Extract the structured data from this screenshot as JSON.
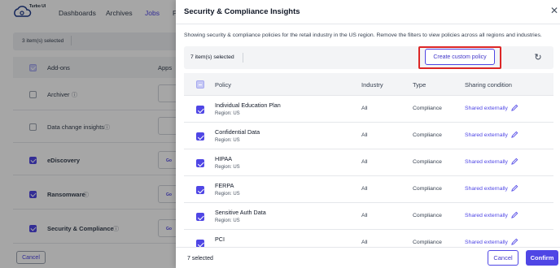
{
  "background": {
    "app_name": "Turbo UI",
    "nav": [
      "Dashboards",
      "Archives",
      "Jobs",
      "P"
    ],
    "active_nav": "Jobs",
    "selected_text": "3 item(s) selected",
    "columns": {
      "addons": "Add-ons",
      "apps": "Apps"
    },
    "rows": [
      {
        "label": "Archiver",
        "checked": false,
        "info_icon": "info-icon"
      },
      {
        "label": "Data change insights",
        "checked": false,
        "info_icon": "info-icon"
      },
      {
        "label": "eDiscovery",
        "checked": true,
        "chip": "Go"
      },
      {
        "label": "Ransomware",
        "checked": true,
        "info_icon": "info-icon",
        "chip": "Go"
      },
      {
        "label": "Security & Compliance",
        "checked": true,
        "info_icon": "info-icon",
        "chip": "Go"
      }
    ],
    "cancel_label": "Cancel"
  },
  "drawer": {
    "title": "Security & Compliance Insights",
    "close_icon": "close-icon",
    "description": "Showing security & compliance policies for the retail industry in the US region. Remove the filters to view policies across all regions and industries.",
    "toolbar": {
      "selected_text": "7 item(s) selected",
      "create_label": "Create custom policy",
      "refresh_icon": "refresh-icon"
    },
    "table": {
      "headers": {
        "policy": "Policy",
        "industry": "Industry",
        "type": "Type",
        "sharing": "Sharing condition"
      },
      "rows": [
        {
          "name": "Individual Education Plan",
          "region": "Region: US",
          "industry": "All",
          "type": "Compliance",
          "sharing": "Shared externally"
        },
        {
          "name": "Confidential Data",
          "region": "Region: US",
          "industry": "All",
          "type": "Compliance",
          "sharing": "Shared externally"
        },
        {
          "name": "HIPAA",
          "region": "Region: US",
          "industry": "All",
          "type": "Compliance",
          "sharing": "Shared externally"
        },
        {
          "name": "FERPA",
          "region": "Region: US",
          "industry": "All",
          "type": "Compliance",
          "sharing": "Shared externally"
        },
        {
          "name": "Sensitive Auth Data",
          "region": "Region: US",
          "industry": "All",
          "type": "Compliance",
          "sharing": "Shared externally"
        },
        {
          "name": "PCI",
          "region": "",
          "industry": "All",
          "type": "Compliance",
          "sharing": "Shared externally"
        }
      ]
    },
    "footer": {
      "selected_text": "7 selected",
      "cancel_label": "Cancel",
      "confirm_label": "Confirm"
    }
  },
  "colors": {
    "accent": "#4f46e5",
    "highlight": "#dc2626",
    "overlay": "rgba(0,0,0,0.35)"
  }
}
